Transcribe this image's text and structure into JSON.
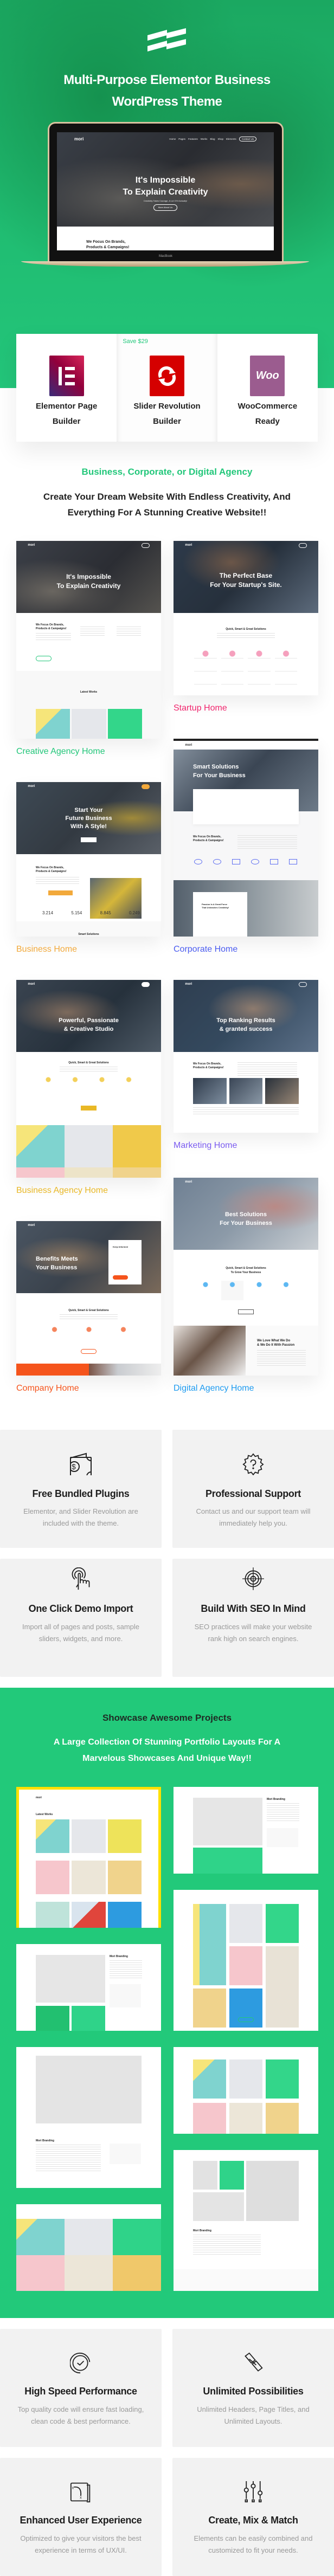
{
  "hero": {
    "title": "Multi-Purpose Elementor Business\nWordPress Theme",
    "laptop": {
      "logo": "mori",
      "nav": [
        "Home",
        "Pages",
        "Features",
        "Works",
        "Blog",
        "Shop",
        "Elements"
      ],
      "cta": "Contact Us",
      "headline": "It's Impossible\nTo Explain Creativity",
      "subtitle": "Creativity Takes Courage, A Lot Of It Actually!",
      "button": "More About Us",
      "section_heading": "We Focus On Brands,\nProducts & Campaigns!",
      "brand": "MacBook"
    }
  },
  "plugins": {
    "save_badge": "Save $29",
    "items": [
      {
        "label": "Elementor Page\nBuilder",
        "icon": "elementor-logo",
        "color": "#92003b"
      },
      {
        "label": "Slider Revolution\nBuilder",
        "icon": "slider-revolution-logo",
        "color": "#d50000"
      },
      {
        "label": "WooCommerce\nReady",
        "icon": "woocommerce-logo",
        "logo_text": "Woo",
        "color": "#9b5c8f"
      }
    ]
  },
  "tagline": "Business, Corporate, or Digital Agency",
  "intro": "Create Your Dream Website With Endless Creativity, And\nEverything For A Stunning Creative Website!!",
  "demos": [
    {
      "label": "Creative Agency Home",
      "color": "#22c77a",
      "headline": "It's Impossible\nTo Explain Creativity",
      "section": "We Focus On Brands,\nProducts & Campaigns!",
      "section2": "Latest Works"
    },
    {
      "label": "Startup Home",
      "color": "#f0246c",
      "headline": "The Perfect Base\nFor Your Startup's Site.",
      "section": "Quick, Smart & Great Solutions"
    },
    {
      "label": "Business Home",
      "color": "#f2a93b",
      "headline": "Start Your\nFuture Business\nWith A Style!",
      "section": "We Focus On Brands,\nProducts & Campaigns!",
      "stats": [
        "3.214",
        "5.154",
        "8.845",
        "0.249"
      ],
      "section2": "Smart Solutions"
    },
    {
      "label": "Corporate Home",
      "color": "#4b5cf0",
      "headline": "Smart Solutions\nFor Your Business",
      "section": "We Focus On Brands,\nProducts & Campaigns!",
      "box": "Passion Is A Great Force\nThat Unleashes Creativity!"
    },
    {
      "label": "Business Agency Home",
      "color": "#e9b826",
      "headline": "Powerful, Passionate\n& Creative Studio",
      "section": "Quick, Smart & Great Solutions"
    },
    {
      "label": "Marketing Home",
      "color": "#7b5cf0",
      "headline": "Top Ranking Results\n& granted success",
      "section": "We Focus On Brands,\nProducts & Campaigns!"
    },
    {
      "label": "Company Home",
      "color": "#f5541c",
      "headline": "Benefits Meets\nYour Business",
      "form_title": "Keep Informed",
      "section": "Quick, Smart & Great Solutions"
    },
    {
      "label": "Digital Agency Home",
      "color": "#1e9bf0",
      "headline": "Best Solutions\nFor Your Business",
      "section": "Quick, Smart & Great Solutions\nTo Grow Your Business",
      "box": "We Love What We Do\n& We Do It With Passion"
    }
  ],
  "features": [
    {
      "title": "Free Bundled Plugins",
      "desc": "Elementor, and Slider Revolution are\nincluded with the theme.",
      "icon": "money-wallet-icon"
    },
    {
      "title": "Professional Support",
      "desc": "Contact us and our support team will\nimmediately help you.",
      "icon": "gear-question-icon"
    },
    {
      "title": "One Click Demo Import",
      "desc": "Import all of pages and posts, sample\nsliders, widgets, and more.",
      "icon": "touch-click-icon"
    },
    {
      "title": "Build With SEO In Mind",
      "desc": "SEO practices will make your website\nrank high on search engines.",
      "icon": "target-icon"
    },
    {
      "title": "High Speed Performance",
      "desc": "Top quality code will ensure fast loading,\nclean code & best performance.",
      "icon": "timer-check-icon"
    },
    {
      "title": "Unlimited Possibilities",
      "desc": "Unlimited Headers, Page Titles, and\nUnlimited Layouts.",
      "icon": "chain-link-icon"
    },
    {
      "title": "Enhanced User Experience",
      "desc": "Optimized to give your visitors the best\nexperience in terms of UX/UI.",
      "icon": "map-route-icon"
    },
    {
      "title": "Create, Mix & Match",
      "desc": "Elements can be easily combined and\ncustomized to fit your needs.",
      "icon": "sliders-icon"
    }
  ],
  "showcase": {
    "title": "Showcase Awesome Projects",
    "subtitle": "A Large Collection Of Stunning Portfolio Layouts For A\nMarvelous Showcases And Unique Way!!",
    "logo": "mori",
    "latest_works": "Latest Works",
    "project": "Mori Branding"
  },
  "colors": {
    "brand_green": "#22c97a",
    "feature_bg": "#f2f2f2"
  }
}
